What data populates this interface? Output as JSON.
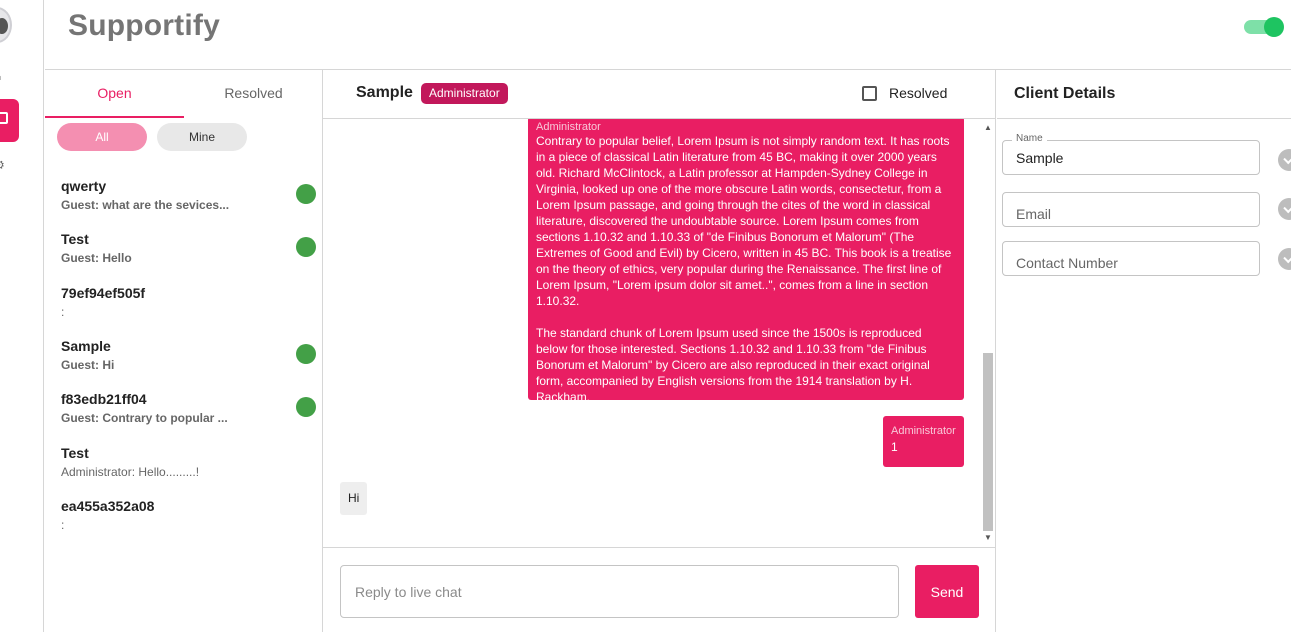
{
  "app": {
    "brand": "Supportify",
    "online_toggle": "on"
  },
  "rail": {
    "items": [
      "avatar",
      "home-icon",
      "chat-icon",
      "settings-icon"
    ],
    "active": "chat-icon"
  },
  "list": {
    "tabs": {
      "open": "Open",
      "resolved": "Resolved"
    },
    "filters": {
      "all": "All",
      "mine": "Mine"
    },
    "conversations": [
      {
        "name": "qwerty",
        "preview": "Guest: what are the sevices...",
        "online": true
      },
      {
        "name": "Test",
        "preview": "Guest: Hello",
        "online": true
      },
      {
        "name": "79ef94ef505f",
        "preview": ":",
        "online": false
      },
      {
        "name": "Sample",
        "preview": "Guest: Hi",
        "online": true
      },
      {
        "name": "f83edb21ff04",
        "preview": "Guest: Contrary to popular ...",
        "online": true
      },
      {
        "name": "Test",
        "preview": "Administrator: Hello.........!",
        "online": false
      },
      {
        "name": "ea455a352a08",
        "preview": ":",
        "online": false
      }
    ]
  },
  "chat": {
    "title": "Sample",
    "role_badge": "Administrator",
    "resolved_label": "Resolved",
    "messages": [
      {
        "sender": "Administrator",
        "text": "Contrary to popular belief, Lorem Ipsum is not simply random text. It has roots in a piece of classical Latin literature from 45 BC, making it over 2000 years old. Richard McClintock, a Latin professor at Hampden-Sydney College in Virginia, looked up one of the more obscure Latin words, consectetur, from a Lorem Ipsum passage, and going through the cites of the word in classical literature, discovered the undoubtable source. Lorem Ipsum comes from sections 1.10.32 and 1.10.33 of \"de Finibus Bonorum et Malorum\" (The Extremes of Good and Evil) by Cicero, written in 45 BC. This book is a treatise on the theory of ethics, very popular during the Renaissance. The first line of Lorem Ipsum, \"Lorem ipsum dolor sit amet..\", comes from a line in section 1.10.32.\n\nThe standard chunk of Lorem Ipsum used since the 1500s is reproduced below for those interested. Sections 1.10.32 and 1.10.33 from \"de Finibus Bonorum et Malorum\" by Cicero are also reproduced in their exact original form, accompanied by English versions from the 1914 translation by H. Rackham."
      },
      {
        "sender": "Administrator",
        "text": "1"
      },
      {
        "sender": "Guest",
        "text": "Hi"
      }
    ],
    "reply_placeholder": "Reply to live chat",
    "send_label": "Send"
  },
  "details": {
    "title": "Client Details",
    "name_legend": "Name",
    "name_value": "Sample",
    "email_placeholder": "Email",
    "contact_placeholder": "Contact Number"
  }
}
